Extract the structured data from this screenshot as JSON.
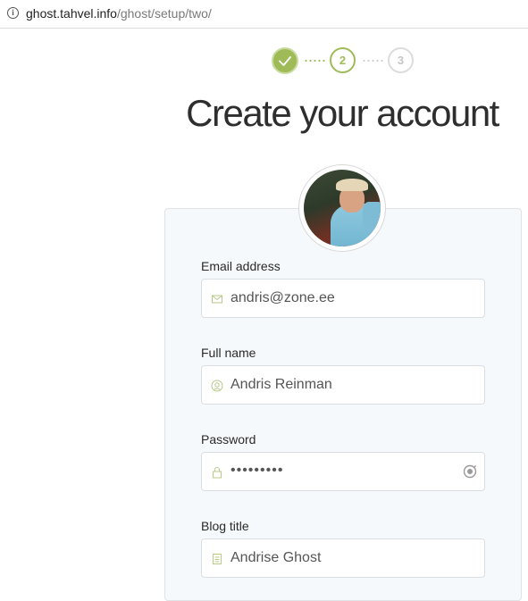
{
  "browser": {
    "url_host": "ghost.tahvel.info",
    "url_path": "/ghost/setup/two/"
  },
  "steps": [
    {
      "label": "",
      "state": "done"
    },
    {
      "label": "2",
      "state": "current"
    },
    {
      "label": "3",
      "state": "upcoming"
    }
  ],
  "page_title": "Create your account",
  "form": {
    "email_label": "Email address",
    "email_value": "andris@zone.ee",
    "name_label": "Full name",
    "name_value": "Andris Reinman",
    "password_label": "Password",
    "password_value": "•••••••••",
    "blog_label": "Blog title",
    "blog_value": "Andrise Ghost"
  },
  "icons": {
    "email": "envelope-icon",
    "name": "user-icon",
    "password": "lock-icon",
    "blog": "document-icon",
    "password_toggle": "eye-icon"
  },
  "colors": {
    "accent": "#9fbb58",
    "step_inactive": "#dcdcdc",
    "card_bg": "#f6f9fb"
  }
}
